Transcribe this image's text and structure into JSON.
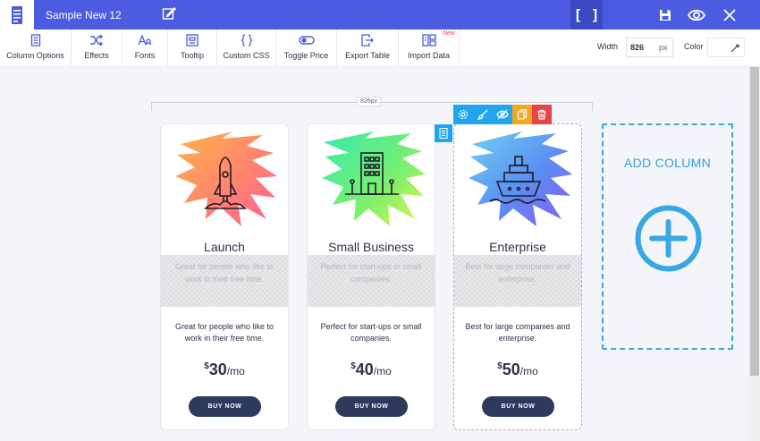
{
  "app": {
    "title": "Sample New 12",
    "bracket_label": "[ ]"
  },
  "toolbar": {
    "items": [
      {
        "label": "Column Options",
        "icon": "document-icon"
      },
      {
        "label": "Effects",
        "icon": "shuffle-icon"
      },
      {
        "label": "Fonts",
        "icon": "font-icon"
      },
      {
        "label": "Tooltip",
        "icon": "tooltip-icon"
      },
      {
        "label": "Custom CSS",
        "icon": "braces-icon"
      },
      {
        "label": "Toggle Price",
        "icon": "toggle-icon"
      },
      {
        "label": "Export Table",
        "icon": "export-icon"
      },
      {
        "label": "Import Data",
        "icon": "import-icon",
        "badge": "New"
      }
    ],
    "width_label": "Width",
    "width_value": "826",
    "width_unit": "px",
    "color_label": "Color"
  },
  "ruler": {
    "label": "826px"
  },
  "cards": [
    {
      "title": "Launch",
      "hatch_text": "Great for people who like to work in their free time.",
      "description": "Great for people who like to work in their free time.",
      "currency": "$",
      "price": "30",
      "period": "/mo",
      "button": "BUY NOW",
      "icon": "rocket-icon"
    },
    {
      "title": "Small Business",
      "hatch_text": "Perfect for start-ups or small companies.",
      "description": "Perfect for start-ups or small companies.",
      "currency": "$",
      "price": "40",
      "period": "/mo",
      "button": "BUY NOW",
      "icon": "building-icon"
    },
    {
      "title": "Enterprise",
      "hatch_text": "Best for large companies and enterprise.",
      "description": "Best for large companies and enterprise.",
      "currency": "$",
      "price": "50",
      "period": "/mo",
      "button": "BUY NOW",
      "icon": "ship-icon"
    }
  ],
  "add_column": {
    "label": "ADD COLUMN"
  },
  "colors": {
    "topbar": "#4c5ce0",
    "accent": "#20a6f0",
    "orange": "#f5a623",
    "red": "#e64545",
    "button": "#2d3a5e",
    "add_column": "#39a7e4"
  }
}
